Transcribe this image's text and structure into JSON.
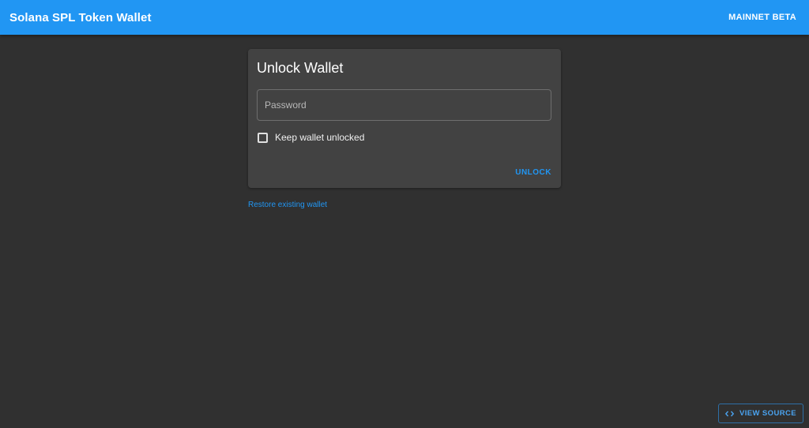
{
  "header": {
    "title": "Solana SPL Token Wallet",
    "network_label": "MAINNET BETA"
  },
  "unlock_card": {
    "title": "Unlock Wallet",
    "password_placeholder": "Password",
    "password_value": "",
    "keep_unlocked_label": "Keep wallet unlocked",
    "keep_unlocked_checked": false,
    "unlock_label": "UNLOCK"
  },
  "restore_link": "Restore existing wallet",
  "footer": {
    "view_source_label": "VIEW SOURCE",
    "view_source_icon": "code-icon"
  },
  "colors": {
    "appbar": "#2196f3",
    "background": "#303030",
    "card": "#424242",
    "accent": "#2196f3"
  }
}
